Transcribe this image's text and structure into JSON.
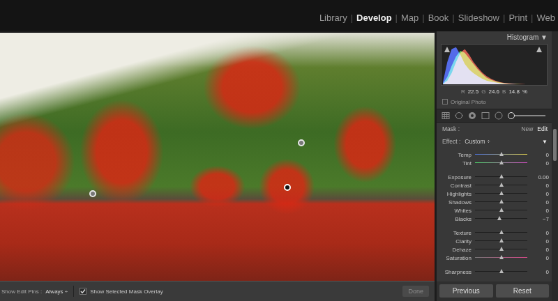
{
  "nav": {
    "separator": "|",
    "items": [
      {
        "label": "Library",
        "selected": false
      },
      {
        "label": "Develop",
        "selected": true
      },
      {
        "label": "Map",
        "selected": false
      },
      {
        "label": "Book",
        "selected": false
      },
      {
        "label": "Slideshow",
        "selected": false
      },
      {
        "label": "Print",
        "selected": false
      },
      {
        "label": "Web",
        "selected": false
      }
    ]
  },
  "photo": {
    "mask_overlay": true,
    "pins": [
      {
        "selected": false
      },
      {
        "selected": false
      },
      {
        "selected": true
      }
    ]
  },
  "toolbar": {
    "pins_label": "Show Edit Pins :",
    "pins_value": "Always",
    "pins_arrow": "÷",
    "overlay_label": "Show Selected Mask Overlay",
    "overlay_checked": true,
    "done": "Done",
    "done_disabled": true
  },
  "histogram": {
    "title": "Histogram",
    "arrow": "▼",
    "series": [
      {
        "name": "red",
        "color": "#e04a3a",
        "values": [
          1,
          10,
          30,
          60,
          85,
          95,
          80,
          60,
          45,
          32,
          22,
          15,
          10,
          6,
          4,
          3,
          2,
          1,
          1,
          0,
          0,
          0,
          0,
          0
        ]
      },
      {
        "name": "green",
        "color": "#3fcf3f",
        "values": [
          2,
          20,
          50,
          75,
          90,
          85,
          70,
          55,
          40,
          28,
          18,
          12,
          8,
          5,
          3,
          2,
          1,
          1,
          0,
          0,
          0,
          0,
          0,
          0
        ]
      },
      {
        "name": "blue",
        "color": "#3f5cff",
        "values": [
          5,
          60,
          95,
          100,
          80,
          55,
          40,
          30,
          22,
          15,
          10,
          7,
          5,
          3,
          2,
          1,
          1,
          0,
          0,
          0,
          0,
          0,
          0,
          0
        ]
      }
    ],
    "readout": [
      {
        "label": "R",
        "value": "22.5"
      },
      {
        "label": "G",
        "value": "24.6"
      },
      {
        "label": "B",
        "value": "14.8"
      }
    ],
    "unit": "%",
    "original_label": "Original Photo",
    "original_checked": false
  },
  "tools": [
    {
      "kind": "crop",
      "selected": false
    },
    {
      "kind": "spot",
      "selected": false
    },
    {
      "kind": "redeye",
      "selected": false
    },
    {
      "kind": "graduated",
      "selected": false
    },
    {
      "kind": "radial",
      "selected": false
    },
    {
      "kind": "brush",
      "selected": true
    }
  ],
  "mask": {
    "label": "Mask :",
    "new": "New",
    "edit": "Edit",
    "edit_selected": true
  },
  "effect": {
    "label": "Effect :",
    "value": "Custom",
    "arrow": "÷",
    "collapse": "▼"
  },
  "slider_groups": [
    [
      {
        "label": "Temp",
        "value": "0",
        "level": 0.5,
        "kind": "temp"
      },
      {
        "label": "Tint",
        "value": "0",
        "level": 0.5,
        "kind": "tint"
      }
    ],
    [
      {
        "label": "Exposure",
        "value": "0.00",
        "level": 0.5,
        "kind": "plain"
      },
      {
        "label": "Contrast",
        "value": "0",
        "level": 0.5,
        "kind": "plain"
      },
      {
        "label": "Highlights",
        "value": "0",
        "level": 0.5,
        "kind": "plain"
      },
      {
        "label": "Shadows",
        "value": "0",
        "level": 0.5,
        "kind": "plain"
      },
      {
        "label": "Whites",
        "value": "0",
        "level": 0.5,
        "kind": "plain"
      },
      {
        "label": "Blacks",
        "value": "−7",
        "level": 0.465,
        "kind": "plain"
      }
    ],
    [
      {
        "label": "Texture",
        "value": "0",
        "level": 0.5,
        "kind": "plain"
      },
      {
        "label": "Clarity",
        "value": "0",
        "level": 0.5,
        "kind": "plain"
      },
      {
        "label": "Dehaze",
        "value": "0",
        "level": 0.5,
        "kind": "plain"
      },
      {
        "label": "Saturation",
        "value": "0",
        "level": 0.5,
        "kind": "saturation"
      }
    ],
    [
      {
        "label": "Sharpness",
        "value": "0",
        "level": 0.5,
        "kind": "plain"
      }
    ]
  ],
  "buttons": {
    "previous": "Previous",
    "reset": "Reset"
  }
}
